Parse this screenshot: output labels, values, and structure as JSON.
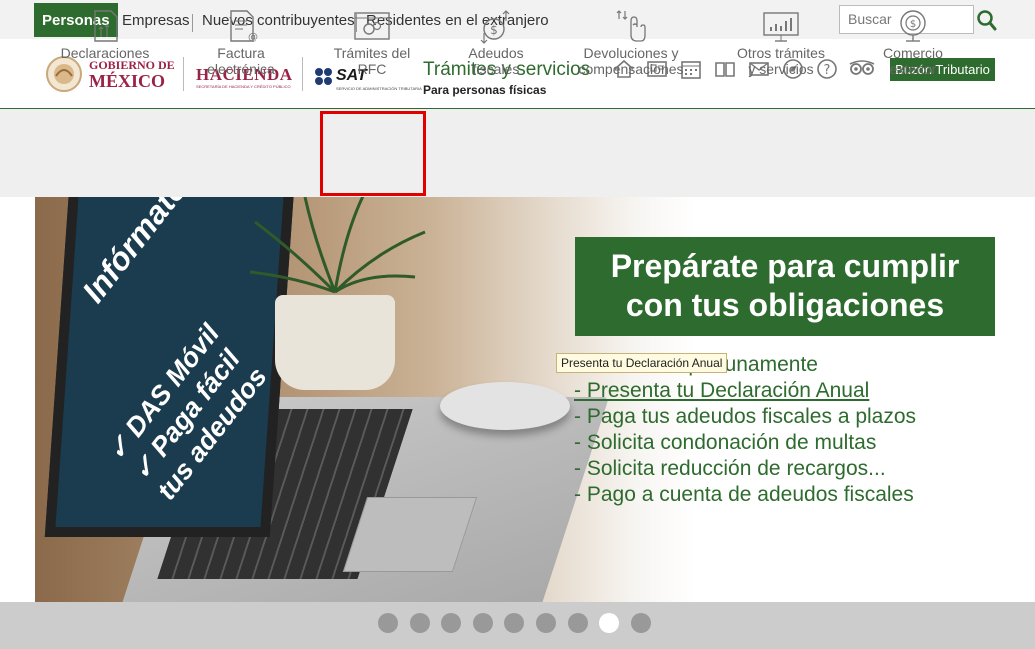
{
  "topbar": {
    "tabs": [
      "Personas",
      "Empresas",
      "Nuevos contribuyentes",
      "Residentes en el extranjero"
    ],
    "active_tab": "Personas",
    "search_placeholder": "Buscar"
  },
  "header": {
    "gob_line1": "GOBIERNO DE",
    "gob_line2": "MÉXICO",
    "hacienda": "HACIENDA",
    "hacienda_sub": "SECRETARÍA DE HACIENDA Y CRÉDITO PÚBLICO",
    "sat": "SAT",
    "sat_sub": "SERVICIO DE ADMINISTRACIÓN TRIBUTARIA",
    "title": "Trámites y servicios",
    "subtitle": "Para personas físicas",
    "icons": [
      "home-icon",
      "id-card-icon",
      "calendar-icon",
      "book-icon",
      "mail-icon",
      "compass-icon",
      "help-icon",
      "accessibility-icon"
    ],
    "buzon_label": "Buzón Tributario",
    "accent": "#2e6b2e",
    "brand_red": "#9b2247"
  },
  "nav": {
    "items": [
      {
        "label1": "Declaraciones",
        "label2": ""
      },
      {
        "label1": "Factura",
        "label2": "electrónica"
      },
      {
        "label1": "Trámites del",
        "label2": "RFC"
      },
      {
        "label1": "Adeudos",
        "label2": "fiscales"
      },
      {
        "label1": "Devoluciones y",
        "label2": "compensaciones"
      },
      {
        "label1": "Otros trámites",
        "label2": "y servicios"
      },
      {
        "label1": "Comercio",
        "label2": "exterior"
      }
    ],
    "highlighted_color": "#e00000"
  },
  "banner": {
    "laptop_heading": "Infórmate:",
    "laptop_bullets": [
      "✓ DAS Móvil",
      "✓ Paga fácil",
      "tus adeudos"
    ],
    "title_line1": "Prepárate para cumplir",
    "title_line2": "con tus obligaciones",
    "list": [
      "- Presenta oportunamente",
      "- Presenta tu Declaración Anual",
      "- Paga tus adeudos fiscales a plazos",
      "- Solicita condonación de multas",
      "- Solicita reducción de recargos...",
      "- Pago a cuenta de adeudos fiscales"
    ],
    "tooltip": "Presenta tu Declaración Anual"
  },
  "carousel": {
    "dot_count": 9,
    "active_index": 7
  }
}
